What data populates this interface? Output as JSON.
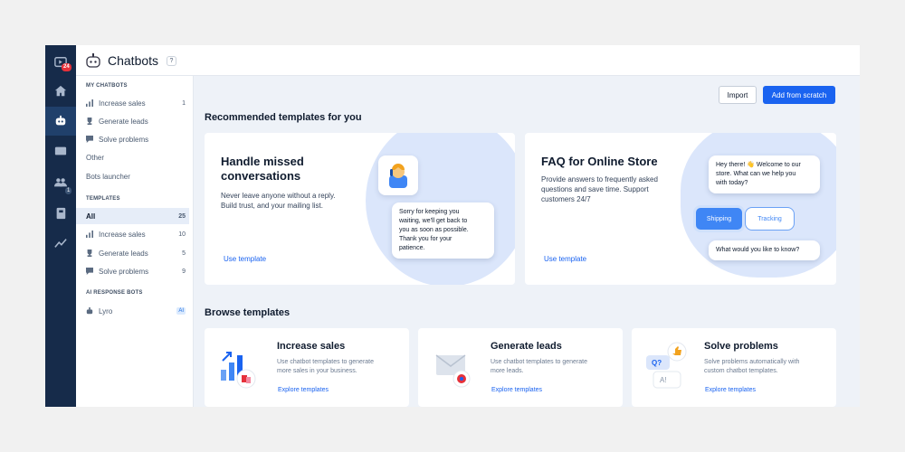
{
  "rail": {
    "notification_count": "24",
    "contacts_count": "1"
  },
  "header": {
    "title": "Chatbots",
    "help": "?"
  },
  "sidebar": {
    "my_chatbots_title": "MY CHATBOTS",
    "my_chatbots": [
      {
        "label": "Increase sales",
        "count": "1",
        "icon": "chart-icon"
      },
      {
        "label": "Generate leads",
        "icon": "trophy-icon"
      },
      {
        "label": "Solve problems",
        "icon": "chat-icon"
      },
      {
        "label": "Other"
      },
      {
        "label": "Bots launcher"
      }
    ],
    "templates_title": "TEMPLATES",
    "templates": [
      {
        "label": "All",
        "count": "25"
      },
      {
        "label": "Increase sales",
        "count": "10",
        "icon": "chart-icon"
      },
      {
        "label": "Generate leads",
        "count": "5",
        "icon": "trophy-icon"
      },
      {
        "label": "Solve problems",
        "count": "9",
        "icon": "chat-icon"
      }
    ],
    "ai_title": "AI RESPONSE BOTS",
    "lyro": {
      "label": "Lyro",
      "badge": "AI"
    }
  },
  "toolbar": {
    "import_label": "Import",
    "add_label": "Add from scratch"
  },
  "recommended": {
    "title": "Recommended templates for you",
    "cards": [
      {
        "title_line1": "Handle missed",
        "title_line2": "conversations",
        "desc_line1": "Never leave anyone without a reply.",
        "desc_line2": "Build trust, and your mailing list.",
        "link": "Use template",
        "bubble": [
          "Sorry for keeping you",
          "waiting, we'll get back to",
          "you as soon as possible.",
          "Thank you for your",
          "patience."
        ]
      },
      {
        "title": "FAQ for Online Store",
        "desc_line1": "Provide answers to frequently asked",
        "desc_line2": "questions and save time. Support",
        "desc_line3": "customers 24/7",
        "link": "Use template",
        "bubble_top": [
          "Hey there! 👋 Welcome to our",
          "store. What can we help you",
          "with today?"
        ],
        "chip_shipping": "Shipping",
        "chip_tracking": "Tracking",
        "bubble_bottom": "What would you like to know?"
      }
    ]
  },
  "browse": {
    "title": "Browse templates",
    "cards": [
      {
        "title": "Increase sales",
        "desc_line1": "Use chatbot templates to generate",
        "desc_line2": "more sales in your business.",
        "link": "Explore templates"
      },
      {
        "title": "Generate leads",
        "desc_line1": "Use chatbot templates to generate",
        "desc_line2": "more leads.",
        "link": "Explore templates"
      },
      {
        "title": "Solve problems",
        "desc_line1": "Solve problems automatically with",
        "desc_line2": "custom chatbot templates.",
        "link": "Explore templates",
        "q_label": "Q?",
        "a_label": "A!"
      }
    ]
  },
  "colors": {
    "rail": "#162b4a",
    "accent": "#1a63f0",
    "background": "#eef2f8"
  }
}
